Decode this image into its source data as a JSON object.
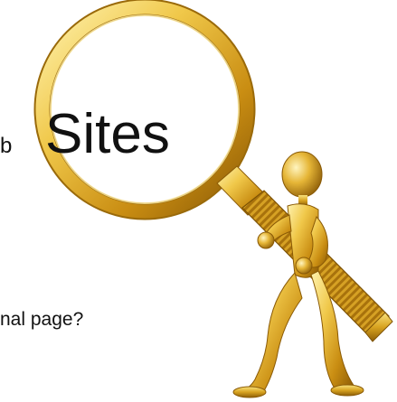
{
  "image": {
    "partial_text": "b",
    "magnified_word": "Sites",
    "bottom_text": "nal page?",
    "colors": {
      "gold_light": "#f7e27a",
      "gold_mid": "#d9a521",
      "gold_dark": "#9a6a0a",
      "lens_glass": "#ffffff",
      "text": "#111111"
    },
    "subject": "gold-figure-with-magnifying-glass"
  }
}
